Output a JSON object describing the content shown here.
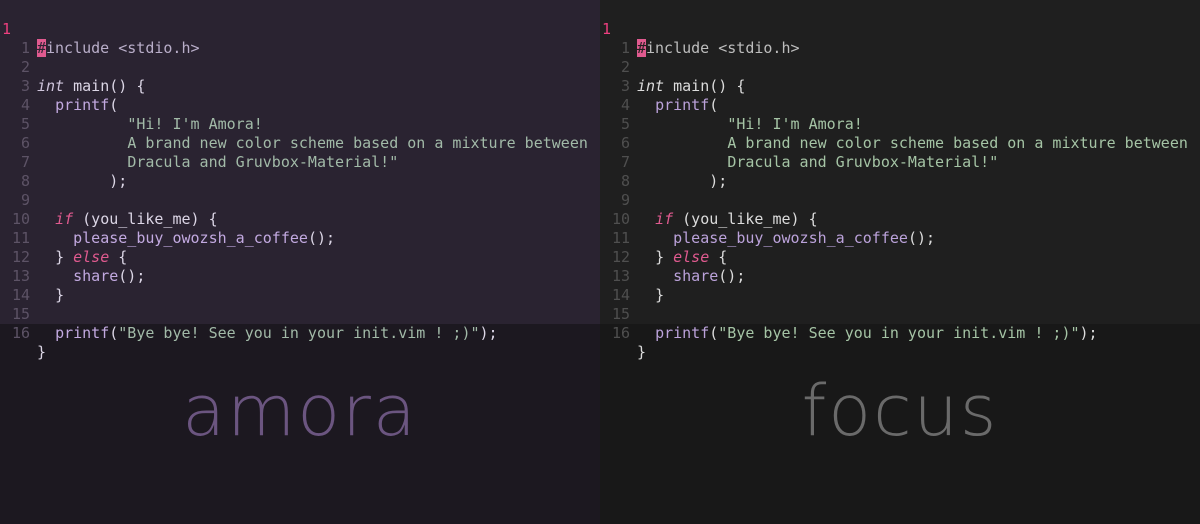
{
  "panels": [
    {
      "brand": "amora",
      "lines": [
        {
          "num": "1",
          "current": true
        },
        {
          "num": "1"
        },
        {
          "num": "2"
        },
        {
          "num": "3"
        },
        {
          "num": "4"
        },
        {
          "num": "5"
        },
        {
          "num": "6"
        },
        {
          "num": "7"
        },
        {
          "num": "8"
        },
        {
          "num": "9"
        },
        {
          "num": "10"
        },
        {
          "num": "11"
        },
        {
          "num": "12"
        },
        {
          "num": "13"
        },
        {
          "num": "14"
        },
        {
          "num": "15"
        },
        {
          "num": "16"
        }
      ]
    },
    {
      "brand": "focus",
      "lines": [
        {
          "num": "1",
          "current": true
        },
        {
          "num": "1"
        },
        {
          "num": "2"
        },
        {
          "num": "3"
        },
        {
          "num": "4"
        },
        {
          "num": "5"
        },
        {
          "num": "6"
        },
        {
          "num": "7"
        },
        {
          "num": "8"
        },
        {
          "num": "9"
        },
        {
          "num": "10"
        },
        {
          "num": "11"
        },
        {
          "num": "12"
        },
        {
          "num": "13"
        },
        {
          "num": "14"
        },
        {
          "num": "15"
        },
        {
          "num": "16"
        }
      ]
    }
  ],
  "code": {
    "l0_cursor": "#",
    "l0_rest": "include <stdio.h>",
    "l2_type": "int",
    "l2_fn": "main",
    "l2_rest": "() {",
    "l3_fn": "printf",
    "l3_rest": "(",
    "l4": "\"Hi! I'm Amora!",
    "l5": "A brand new color scheme based on a mixture between",
    "l6": "Dracula and Gruvbox-Material!\"",
    "l7": ");",
    "l9_kw": "if",
    "l9_rest": " (you_like_me) {",
    "l10_fn": "please_buy_owozsh_a_coffee",
    "l10_rest": "();",
    "l11_pre": "} ",
    "l11_kw": "else",
    "l11_rest": " {",
    "l12_fn": "share",
    "l12_rest": "();",
    "l13": "}",
    "l15_fn": "printf",
    "l15_open": "(",
    "l15_str": "\"Bye bye! See you in your init.vim ! ;)\"",
    "l15_close": ");",
    "l16": "}"
  },
  "colors": {
    "amora_bg": "#2a2331",
    "focus_bg": "#1f1f1f",
    "accent": "#e05a8f"
  }
}
